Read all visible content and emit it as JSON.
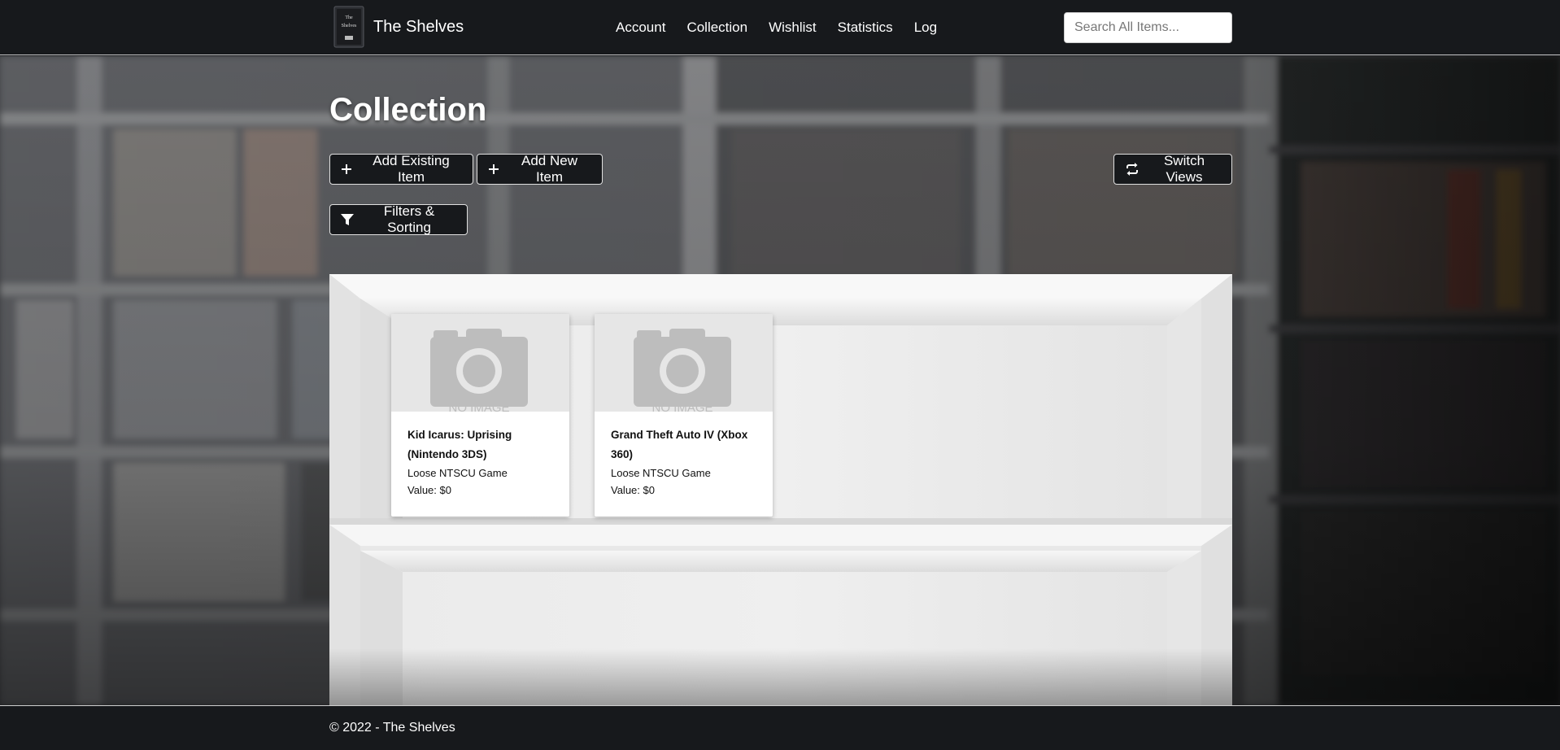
{
  "brand": {
    "name": "The Shelves",
    "logo_text": [
      "The",
      "Shelves"
    ]
  },
  "nav": {
    "links": [
      "Account",
      "Collection",
      "Wishlist",
      "Statistics",
      "Log"
    ]
  },
  "search": {
    "placeholder": "Search All Items..."
  },
  "page": {
    "title": "Collection"
  },
  "toolbar": {
    "add_existing_label": "Add Existing Item",
    "add_new_label": "Add New Item",
    "switch_views_label": "Switch Views",
    "filters_label": "Filters & Sorting"
  },
  "items": [
    {
      "title": "Kid Icarus: Uprising (Nintendo 3DS)",
      "condition": "Loose NTSCU Game",
      "value": "Value: $0",
      "image_text": "NO IMAGE"
    },
    {
      "title": "Grand Theft Auto IV (Xbox 360)",
      "condition": "Loose NTSCU Game",
      "value": "Value: $0",
      "image_text": "NO IMAGE"
    }
  ],
  "footer": {
    "text": "© 2022 - The Shelves"
  },
  "colors": {
    "navbar": "#17191c",
    "button_bg": "#17191c",
    "placeholder_gray": "#bdbdbd"
  },
  "icons": [
    "plus-icon",
    "funnel-icon",
    "switch-arrows-icon",
    "camera-placeholder-icon"
  ]
}
